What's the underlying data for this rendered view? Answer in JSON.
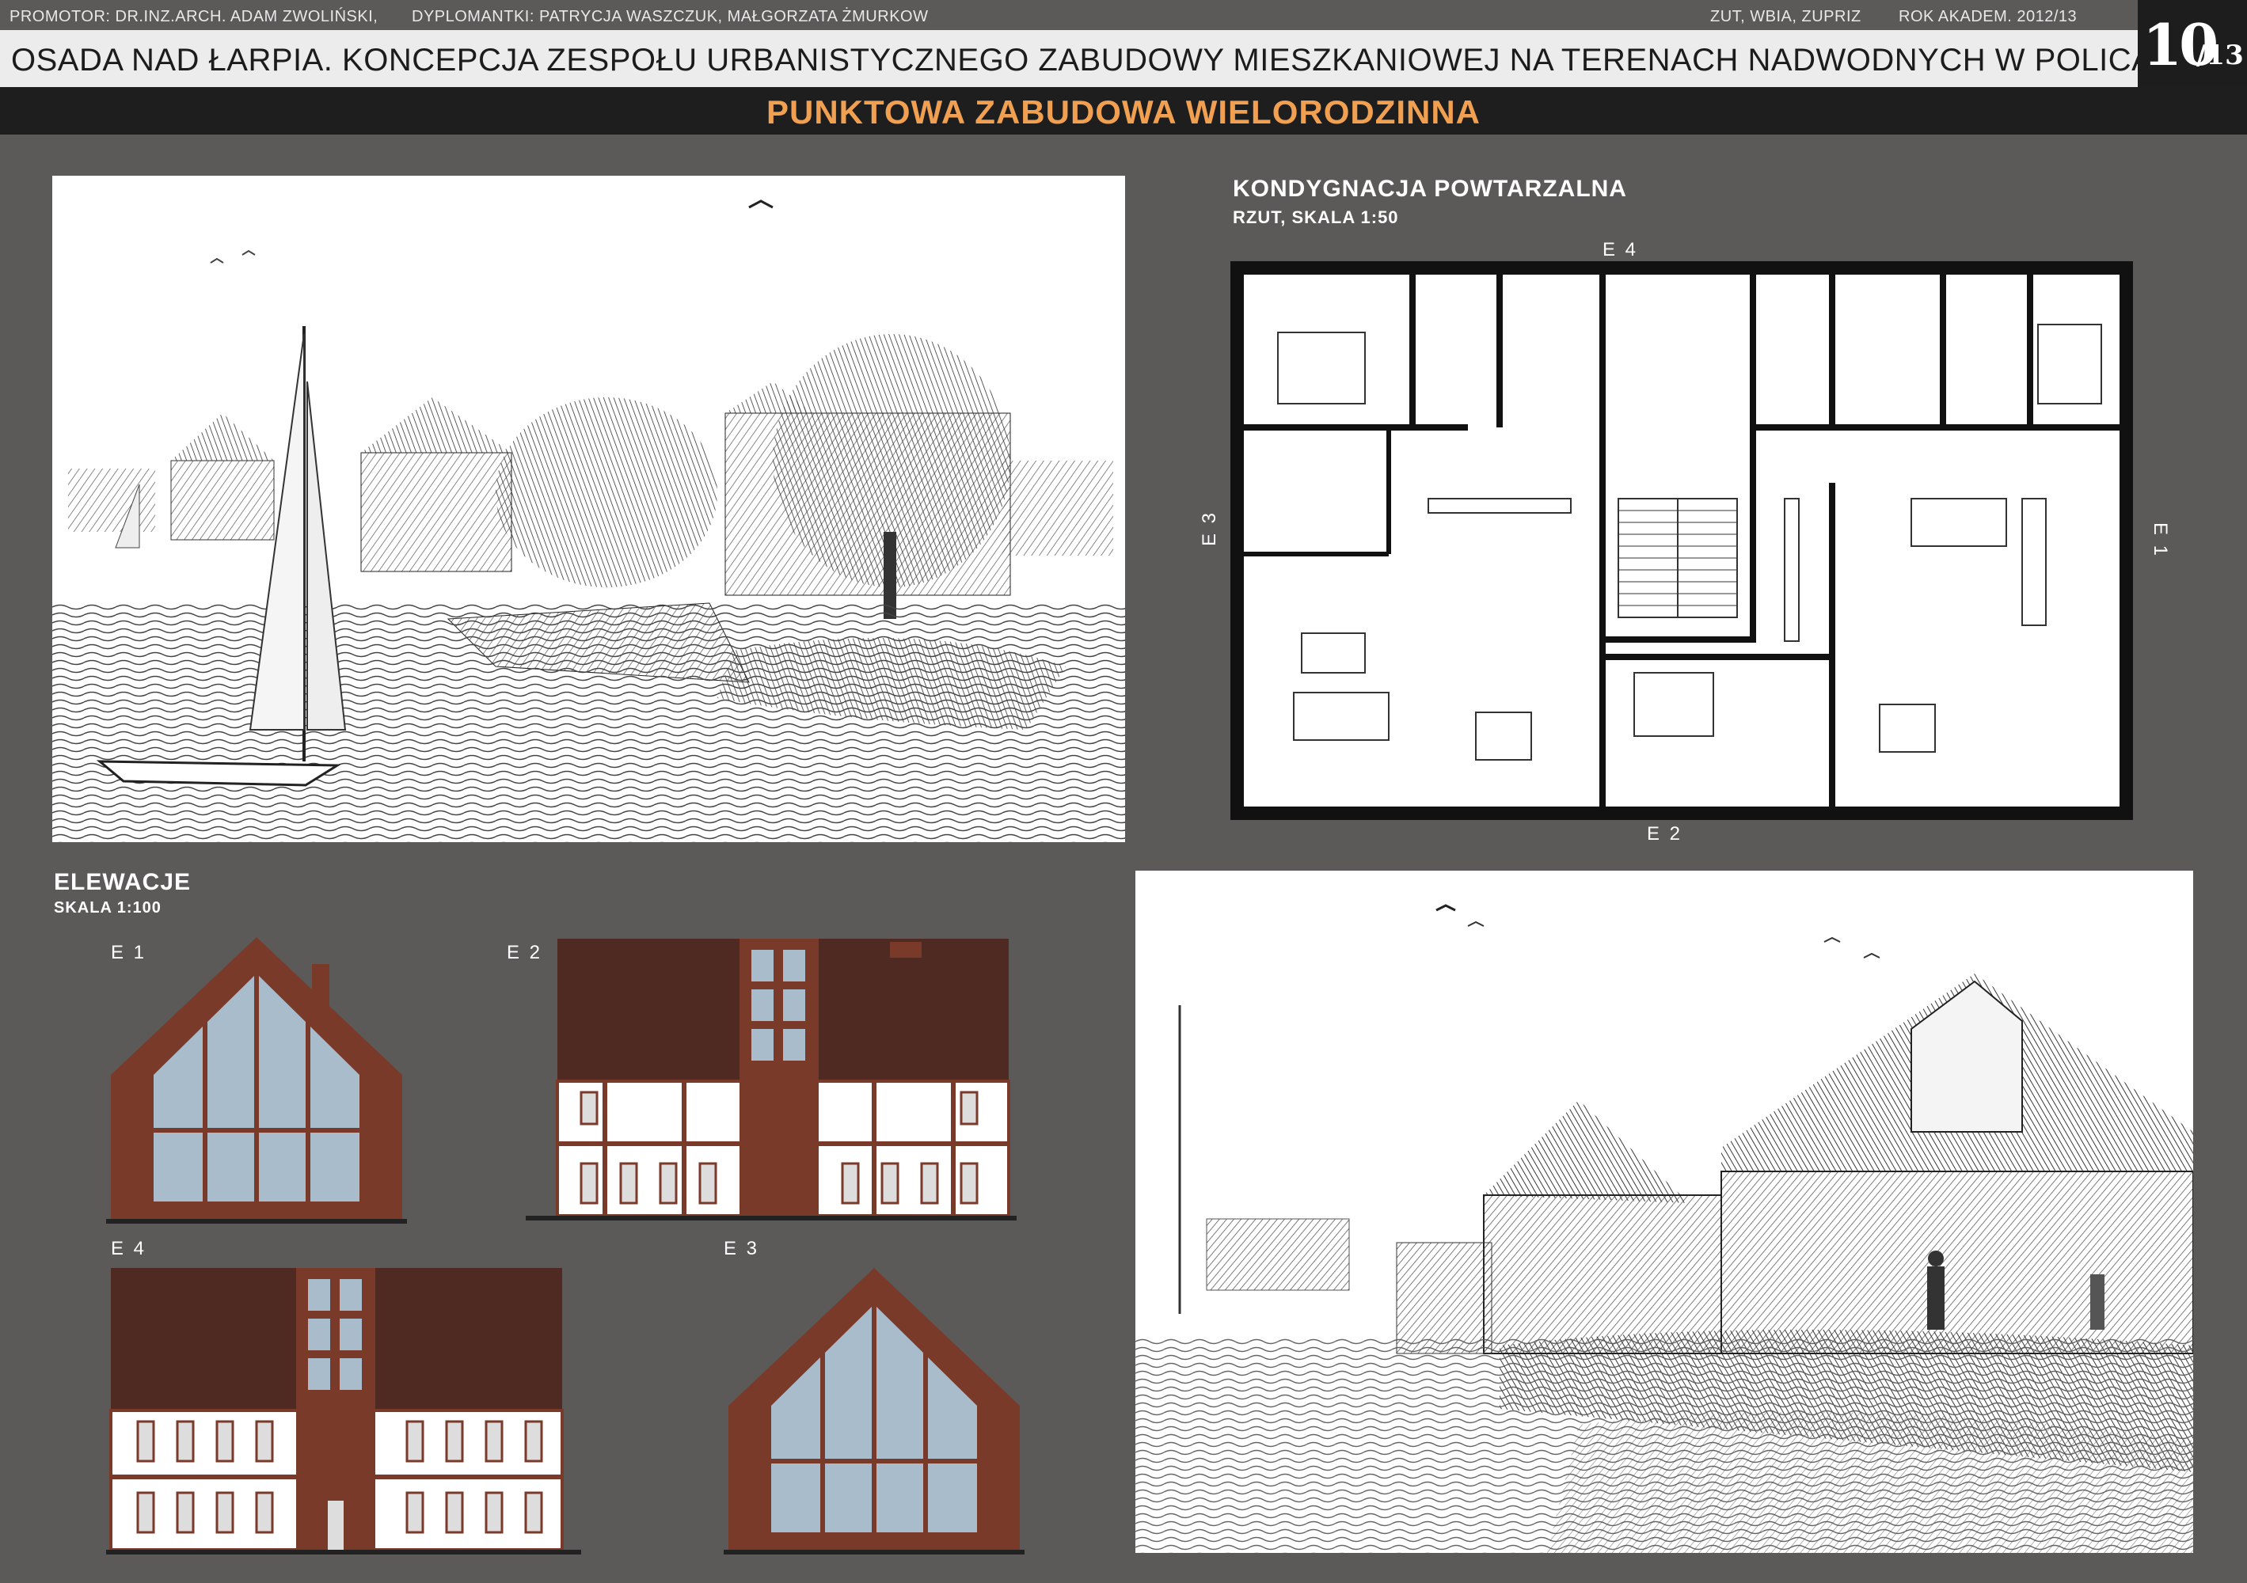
{
  "header": {
    "promoter": "PROMOTOR: DR.INZ.ARCH. ADAM ZWOLIŃSKI,",
    "students": "DYPLOMANTKI: PATRYCJA WASZCZUK, MAŁGORZATA ŻMURKOW",
    "institution": "ZUT, WBIA, ZUPRIZ",
    "academic_year": "ROK AKADEM.  2012/13",
    "title": "OSADA NAD ŁARPIA. KONCEPCJA ZESPOŁU  URBANISTYCZNEGO  ZABUDOWY MIESZKANIOWEJ NA TERENACH NADWODNYCH W POLICACH.",
    "page_number": "10",
    "page_total": "/13",
    "subtitle": "PUNKTOWA ZABUDOWA WIELORODZINNA"
  },
  "plan": {
    "heading": "KONDYGNACJA POWTARZALNA",
    "subheading": "RZUT, SKALA 1:50",
    "marks": {
      "e1": "E 1",
      "e2": "E 2",
      "e3": "E 3",
      "e4": "E 4"
    }
  },
  "elevations": {
    "heading": "ELEWACJE",
    "scale": "SKALA 1:100",
    "labels": {
      "e1": "E 1",
      "e2": "E 2",
      "e3": "E 3",
      "e4": "E 4"
    }
  },
  "colors": {
    "background": "#5b5a58",
    "accent": "#f0a050",
    "brick": "#7a3a2a",
    "roof": "#4e2a22",
    "glass": "#a9bccb",
    "dark_bar": "#1e1e1e"
  }
}
